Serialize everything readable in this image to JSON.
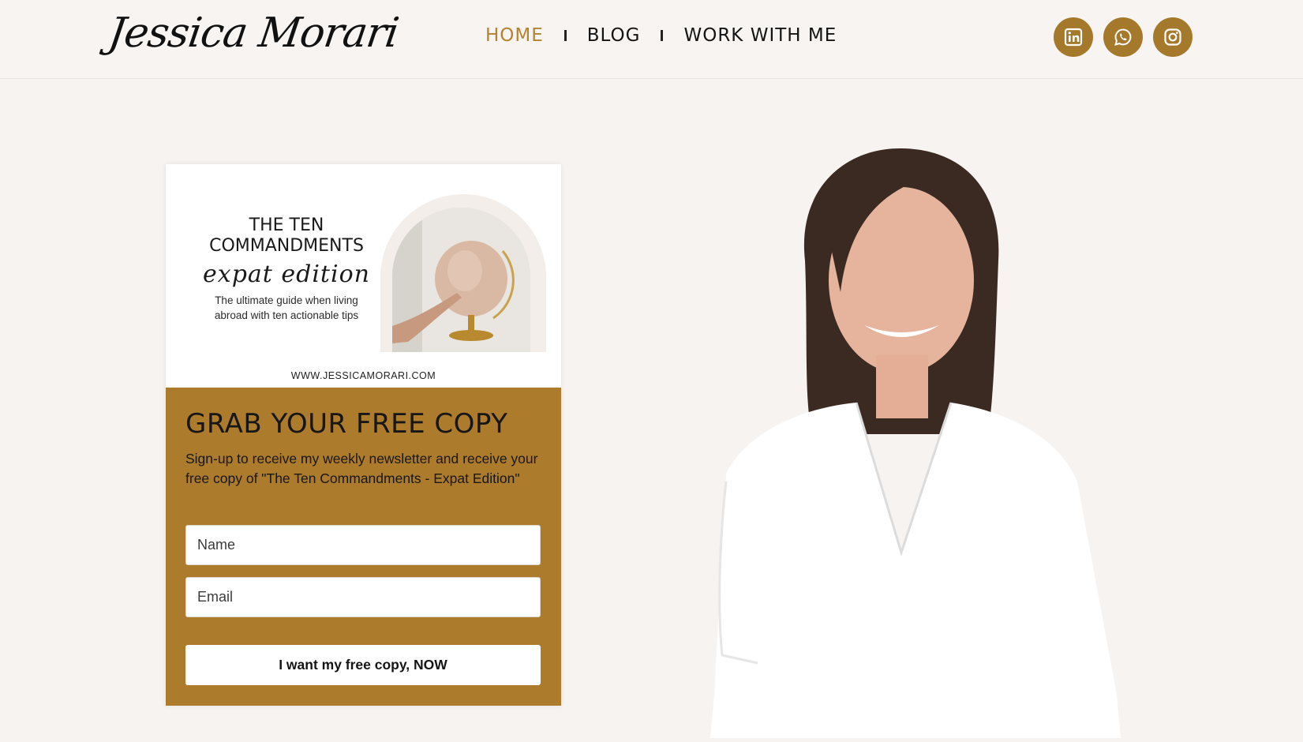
{
  "header": {
    "logo_text": "Jessica Morari",
    "nav": [
      {
        "label": "HOME",
        "active": true
      },
      {
        "label": "BLOG",
        "active": false
      },
      {
        "label": "WORK WITH ME",
        "active": false
      }
    ],
    "socials": [
      {
        "icon": "linkedin-icon"
      },
      {
        "icon": "whatsapp-icon"
      },
      {
        "icon": "instagram-icon"
      }
    ]
  },
  "optin": {
    "book": {
      "title_line1": "THE TEN",
      "title_line2": "COMMANDMENTS",
      "script": "expat edition",
      "subtitle_line1": "The ultimate guide when living",
      "subtitle_line2": "abroad with ten actionable tips",
      "url": "WWW.JESSICAMORARI.COM"
    },
    "heading": "GRAB YOUR FREE COPY",
    "description": "Sign-up to receive my weekly newsletter and receive your free copy of \"The Ten Commandments - Expat Edition\"",
    "name_placeholder": "Name",
    "email_placeholder": "Email",
    "submit_label": "I want my free copy, NOW"
  },
  "colors": {
    "accent": "#ad7b2c",
    "active_nav": "#b58230",
    "background": "#f6f3f0"
  }
}
